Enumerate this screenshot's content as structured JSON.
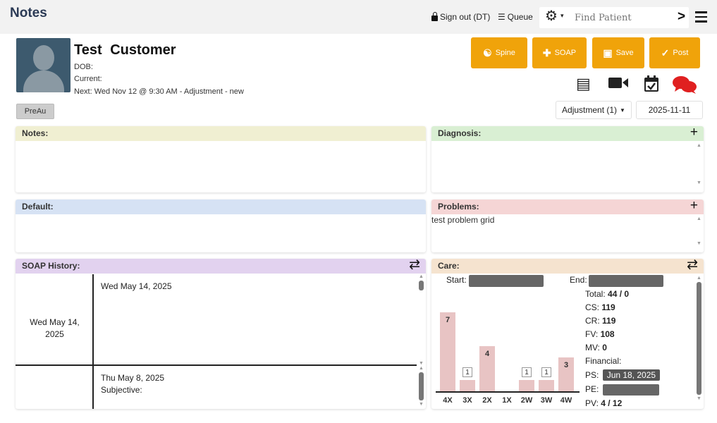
{
  "header": {
    "title": "Notes",
    "sign_out": "Sign out (DT)",
    "queue": "Queue",
    "search_placeholder": "Find Patient"
  },
  "patient": {
    "name": "Test  Customer",
    "dob": "DOB:",
    "current": "Current:",
    "next": "Next: Wed Nov 12 @ 9:30 AM - Adjustment - new",
    "badge": "PreAu"
  },
  "actions": {
    "spine": "Spine",
    "soap": "SOAP",
    "save": "Save",
    "post": "Post"
  },
  "visit": {
    "type": "Adjustment (1)",
    "date": "2025-11-11"
  },
  "panels": {
    "notes": "Notes:",
    "diagnosis": "Diagnosis:",
    "default": "Default:",
    "problems": "Problems:",
    "problems_text": "test problem grid",
    "soap_history": "SOAP History:",
    "care": "Care:"
  },
  "history": [
    {
      "left": "Wed May 14, 2025",
      "date": "Wed May 14, 2025",
      "text": ""
    },
    {
      "left": "",
      "date": "Thu May 8, 2025",
      "text": "Subjective:"
    }
  ],
  "care": {
    "start_label": "Start:",
    "end_label": "End:",
    "bars": [
      {
        "label": "4X",
        "value": 7
      },
      {
        "label": "3X",
        "value": 1
      },
      {
        "label": "2X",
        "value": 4
      },
      {
        "label": "1X",
        "value": 0
      },
      {
        "label": "2W",
        "value": 1
      },
      {
        "label": "3W",
        "value": 1
      },
      {
        "label": "4W",
        "value": 3
      }
    ],
    "total_label": "Total:",
    "total": "44 / 0",
    "cs_label": "CS:",
    "cs": "119",
    "cr_label": "CR:",
    "cr": "119",
    "fv_label": "FV:",
    "fv": "108",
    "mv_label": "MV:",
    "mv": "0",
    "financial_label": "Financial:",
    "ps_label": "PS:",
    "ps": "Jun 18, 2025",
    "pe_label": "PE:",
    "pv_label": "PV:",
    "pv": "4 / 12"
  },
  "colors": {
    "accent": "#f0a30a",
    "notes_header": "#f0efd2",
    "diagnosis_header": "#d9efd3",
    "default_header": "#d6e2f4",
    "problems_header": "#f5d5d5",
    "soap_header": "#e2d2ef",
    "care_header": "#f5e3cf",
    "chat_icon": "#e02020"
  }
}
